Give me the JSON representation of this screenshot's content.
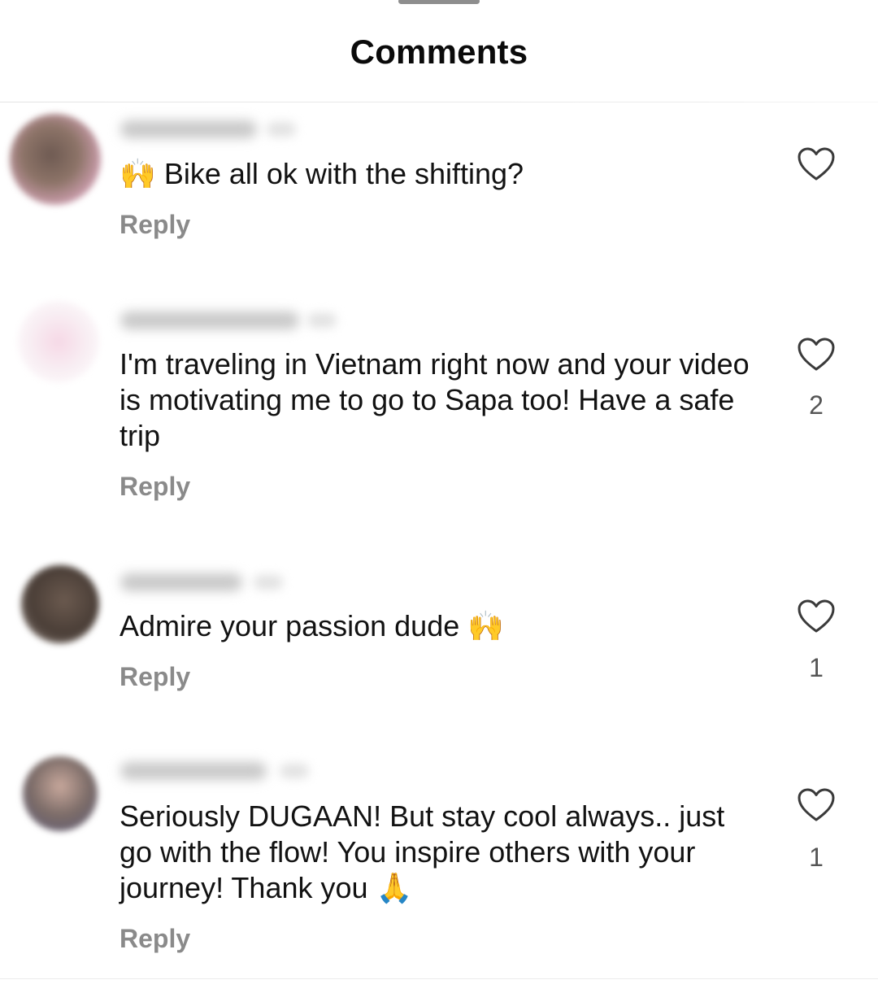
{
  "sheet": {
    "title": "Comments"
  },
  "comments": [
    {
      "emoji_prefix": "🙌",
      "text": "Bike all ok with the shifting?",
      "reply_label": "Reply",
      "like_count": "",
      "avatar_color": "#8a6a5e",
      "icon": "heart-outline-icon"
    },
    {
      "text": "I'm traveling in Vietnam right now and your video is motivating me to go to Sapa too! Have a safe trip",
      "reply_label": "Reply",
      "like_count": "2",
      "avatar_color": "#f3e6ee",
      "icon": "heart-outline-icon"
    },
    {
      "text": "Admire your passion dude",
      "emoji_suffix": "🙌",
      "reply_label": "Reply",
      "like_count": "1",
      "avatar_color": "#5b4a40",
      "icon": "heart-outline-icon"
    },
    {
      "text": "Seriously DUGAAN! But stay cool always.. just go with the flow! You inspire others with your journey! Thank you",
      "emoji_suffix": "🙏",
      "reply_label": "Reply",
      "like_count": "1",
      "avatar_color": "#7b6a66",
      "icon": "heart-outline-icon"
    }
  ]
}
